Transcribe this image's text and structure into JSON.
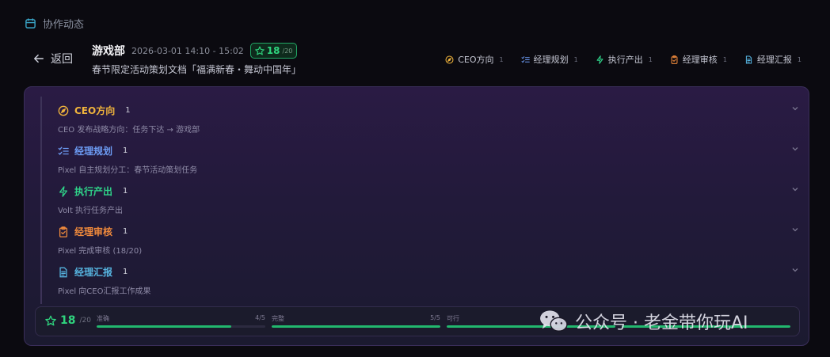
{
  "section": {
    "title": "协作动态",
    "icon": "calendar-icon"
  },
  "back": {
    "label": "返回",
    "icon": "arrow-left-icon"
  },
  "header": {
    "team": "游戏部",
    "time_range": "2026-03-01 14:10 - 15:02",
    "score": "18",
    "score_max": "/20",
    "doc_title": "春节限定活动策划文档「福满新春・舞动中国年」"
  },
  "stage_tabs": [
    {
      "label": "CEO方向",
      "count": "1",
      "icon": "compass-icon",
      "color": "#f0b43c"
    },
    {
      "label": "经理规划",
      "count": "1",
      "icon": "checklist-icon",
      "color": "#6d9cf5"
    },
    {
      "label": "执行产出",
      "count": "1",
      "icon": "lightning-icon",
      "color": "#2fd58a"
    },
    {
      "label": "经理审核",
      "count": "1",
      "icon": "clipboard-check-icon",
      "color": "#f08a3c"
    },
    {
      "label": "经理汇报",
      "count": "1",
      "icon": "document-icon",
      "color": "#56b4e0"
    }
  ],
  "stages": [
    {
      "title": "CEO方向",
      "count": "1",
      "desc": "CEO 发布战略方向：任务下达 → 游戏部",
      "icon": "compass-icon",
      "color": "#f0b43c"
    },
    {
      "title": "经理规划",
      "count": "1",
      "desc": "Pixel 自主规划分工：春节活动策划任务",
      "icon": "checklist-icon",
      "color": "#6d9cf5"
    },
    {
      "title": "执行产出",
      "count": "1",
      "desc": "Volt 执行任务产出",
      "icon": "lightning-icon",
      "color": "#2fd58a"
    },
    {
      "title": "经理审核",
      "count": "1",
      "desc": "Pixel 完成审核 (18/20)",
      "icon": "clipboard-check-icon",
      "color": "#f08a3c"
    },
    {
      "title": "经理汇报",
      "count": "1",
      "desc": "Pixel 向CEO汇报工作成果",
      "icon": "document-icon",
      "color": "#56b4e0"
    }
  ],
  "score_summary": {
    "value": "18",
    "max": "/20",
    "metrics": [
      {
        "label": "准确",
        "value": "4/5",
        "fraction": 0.8
      },
      {
        "label": "完整",
        "value": "5/5",
        "fraction": 1.0
      },
      {
        "label": "可行",
        "value": "",
        "fraction": 1.0
      },
      {
        "label": "",
        "value": "",
        "fraction": 1.0
      }
    ]
  },
  "watermark": {
    "text": "公众号 · 老金带你玩AI",
    "icon": "wechat-icon"
  }
}
